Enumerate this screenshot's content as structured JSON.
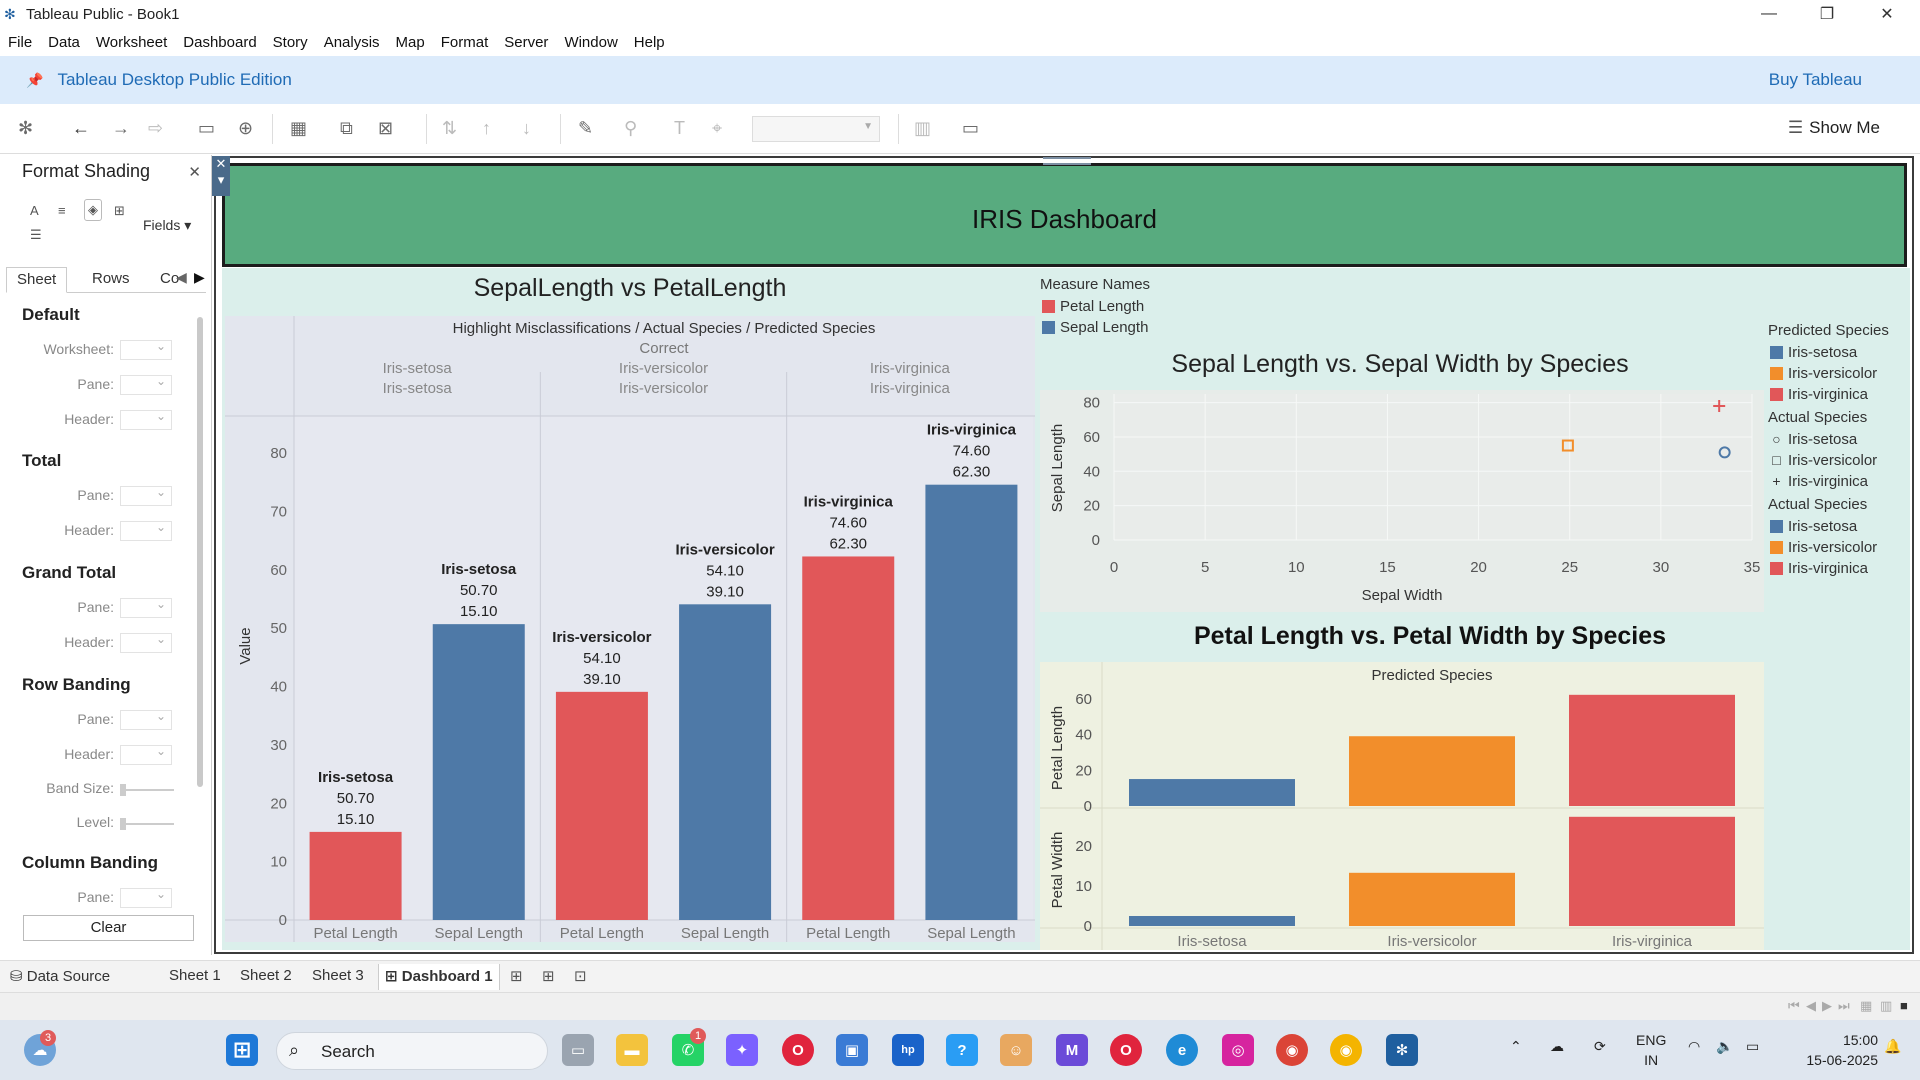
{
  "window": {
    "title": "Tableau Public - Book1"
  },
  "menu": [
    "File",
    "Data",
    "Worksheet",
    "Dashboard",
    "Story",
    "Analysis",
    "Map",
    "Format",
    "Server",
    "Window",
    "Help"
  ],
  "banner": {
    "edition": "Tableau Desktop Public Edition",
    "buy": "Buy Tableau"
  },
  "toolbar": {
    "show_me": "Show Me"
  },
  "format_panel": {
    "title": "Format Shading",
    "fields_label": "Fields ▾",
    "tabs": [
      "Sheet",
      "Rows",
      "Co"
    ],
    "sections": [
      {
        "title": "Default",
        "rows": [
          "Worksheet:",
          "Pane:",
          "Header:"
        ]
      },
      {
        "title": "Total",
        "rows": [
          "Pane:",
          "Header:"
        ]
      },
      {
        "title": "Grand Total",
        "rows": [
          "Pane:",
          "Header:"
        ]
      },
      {
        "title": "Row Banding",
        "rows": [
          "Pane:",
          "Header:",
          "Band Size:",
          "Level:"
        ]
      },
      {
        "title": "Column Banding",
        "rows": [
          "Pane:"
        ]
      }
    ],
    "clear_label": "Clear"
  },
  "dashboard": {
    "title": "IRIS Dashboard"
  },
  "colors": {
    "blue": "#4e79a7",
    "orange": "#f28e2b",
    "red": "#e15759",
    "green_band": "#58ab7f"
  },
  "measure_legend": {
    "title": "Measure Names",
    "items": [
      {
        "label": "Petal Length",
        "color": "#e15759"
      },
      {
        "label": "Sepal Length",
        "color": "#4e79a7"
      }
    ]
  },
  "right_legend": {
    "predicted_title": "Predicted Species",
    "predicted": [
      {
        "label": "Iris-setosa",
        "color": "#4e79a7"
      },
      {
        "label": "Iris-versicolor",
        "color": "#f28e2b"
      },
      {
        "label": "Iris-virginica",
        "color": "#e15759"
      }
    ],
    "actual_shape_title": "Actual Species",
    "actual_shapes": [
      {
        "label": "Iris-setosa",
        "shape": "○"
      },
      {
        "label": "Iris-versicolor",
        "shape": "□"
      },
      {
        "label": "Iris-virginica",
        "shape": "+"
      }
    ],
    "actual_color_title": "Actual Species",
    "actual_colors": [
      {
        "label": "Iris-setosa",
        "color": "#4e79a7"
      },
      {
        "label": "Iris-versicolor",
        "color": "#f28e2b"
      },
      {
        "label": "Iris-virginica",
        "color": "#e15759"
      }
    ]
  },
  "chart_data": [
    {
      "type": "bar",
      "title": "SepalLength vs PetalLength",
      "header": "Highlight Misclassifications / Actual Species / Predicted Species",
      "subheader": "Correct",
      "ylabel": "Value",
      "ylim": [
        0,
        85
      ],
      "yticks": [
        0,
        10,
        20,
        30,
        40,
        50,
        60,
        70,
        80
      ],
      "panes": [
        {
          "actual": "Iris-setosa",
          "predicted": "Iris-setosa"
        },
        {
          "actual": "Iris-versicolor",
          "predicted": "Iris-versicolor"
        },
        {
          "actual": "Iris-virginica",
          "predicted": "Iris-virginica"
        }
      ],
      "bars": [
        {
          "pane": 0,
          "category": "Petal Length",
          "value": 15.1,
          "color": "#e15759",
          "labels": [
            "Iris-setosa",
            "50.70",
            "15.10"
          ]
        },
        {
          "pane": 0,
          "category": "Sepal Length",
          "value": 50.7,
          "color": "#4e79a7",
          "labels": [
            "Iris-setosa",
            "50.70",
            "15.10"
          ]
        },
        {
          "pane": 1,
          "category": "Petal Length",
          "value": 39.1,
          "color": "#e15759",
          "labels": [
            "Iris-versicolor",
            "54.10",
            "39.10"
          ]
        },
        {
          "pane": 1,
          "category": "Sepal Length",
          "value": 54.1,
          "color": "#4e79a7",
          "labels": [
            "Iris-versicolor",
            "54.10",
            "39.10"
          ]
        },
        {
          "pane": 2,
          "category": "Petal Length",
          "value": 62.3,
          "color": "#e15759",
          "labels": [
            "Iris-virginica",
            "74.60",
            "62.30"
          ]
        },
        {
          "pane": 2,
          "category": "Sepal Length",
          "value": 74.6,
          "color": "#4e79a7",
          "labels": [
            "Iris-virginica",
            "74.60",
            "62.30"
          ]
        }
      ]
    },
    {
      "type": "scatter",
      "title": "Sepal Length vs. Sepal Width by Species",
      "xlabel": "Sepal Width",
      "ylabel": "Sepal Length",
      "xlim": [
        0,
        35
      ],
      "ylim": [
        0,
        85
      ],
      "xticks": [
        0,
        5,
        10,
        15,
        20,
        25,
        30,
        35
      ],
      "yticks": [
        0,
        20,
        40,
        60,
        80
      ],
      "points": [
        {
          "species": "Iris-setosa",
          "x": 33.5,
          "y": 51,
          "shape": "circle",
          "color": "#4e79a7"
        },
        {
          "species": "Iris-versicolor",
          "x": 24.9,
          "y": 55,
          "shape": "square",
          "color": "#f28e2b"
        },
        {
          "species": "Iris-virginica",
          "x": 33.2,
          "y": 78,
          "shape": "plus",
          "color": "#e15759"
        }
      ]
    },
    {
      "type": "bar",
      "title": "Petal Length vs. Petal Width by Species",
      "header": "Predicted Species",
      "categories": [
        "Iris-setosa",
        "Iris-versicolor",
        "Iris-virginica"
      ],
      "colors": [
        "#4e79a7",
        "#f28e2b",
        "#e15759"
      ],
      "rows": [
        {
          "measure": "Petal Length",
          "values": [
            15.1,
            39.1,
            62.3
          ],
          "ylim": [
            0,
            65
          ],
          "yticks": [
            0,
            20,
            40,
            60
          ]
        },
        {
          "measure": "Petal Width",
          "values": [
            2.5,
            13.3,
            27.3
          ],
          "ylim": [
            0,
            28
          ],
          "yticks": [
            0,
            10,
            20
          ]
        }
      ]
    }
  ],
  "sheet_tabs": {
    "data_source": "Data Source",
    "tabs": [
      "Sheet 1",
      "Sheet 2",
      "Sheet 3"
    ],
    "active": "Dashboard 1"
  },
  "taskbar": {
    "search": "Search",
    "weather_badge": "3",
    "whatsapp_badge": "1",
    "lang_top": "ENG",
    "lang_bottom": "IN",
    "time": "15:00",
    "date": "15-06-2025"
  }
}
